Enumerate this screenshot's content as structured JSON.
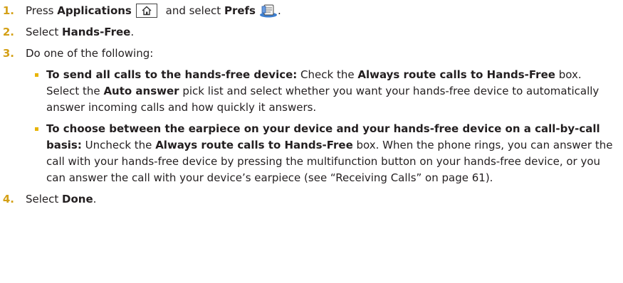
{
  "steps": [
    {
      "num": "1.",
      "a": "Press ",
      "b1": "Applications",
      "c": " and select ",
      "b2": "Prefs"
    },
    {
      "num": "2.",
      "a": "Select ",
      "b1": "Hands-Free",
      "c": "."
    },
    {
      "num": "3.",
      "text": "Do one of the following:"
    },
    {
      "num": "4.",
      "a": "Select ",
      "b1": "Done",
      "c": "."
    }
  ],
  "options": [
    {
      "lead": "To send all calls to the hands-free device:",
      "t1": " Check the ",
      "b1": "Always route calls to Hands-Free",
      "t2": " box. Select the ",
      "b2": "Auto answer",
      "t3": " pick list and select whether you want your hands-free device to automatically answer incoming calls and how quickly it answers."
    },
    {
      "lead": "To choose between the earpiece on your device and your hands-free device on a call-by-call basis:",
      "t1": " Uncheck the ",
      "b1": "Always route calls to Hands-Free",
      "t2": " box. When the phone rings, you can answer the call with your hands-free device by pressing the multifunction button on your hands-free device, or you can answer the call with your device’s earpiece (see “Receiving Calls” on page 61)."
    }
  ],
  "icons": {
    "applications_key": "home-key-icon",
    "prefs": "prefs-icon"
  },
  "colors": {
    "step_number": "#d4a017",
    "bullet": "#e8b400",
    "text": "#231f20"
  }
}
